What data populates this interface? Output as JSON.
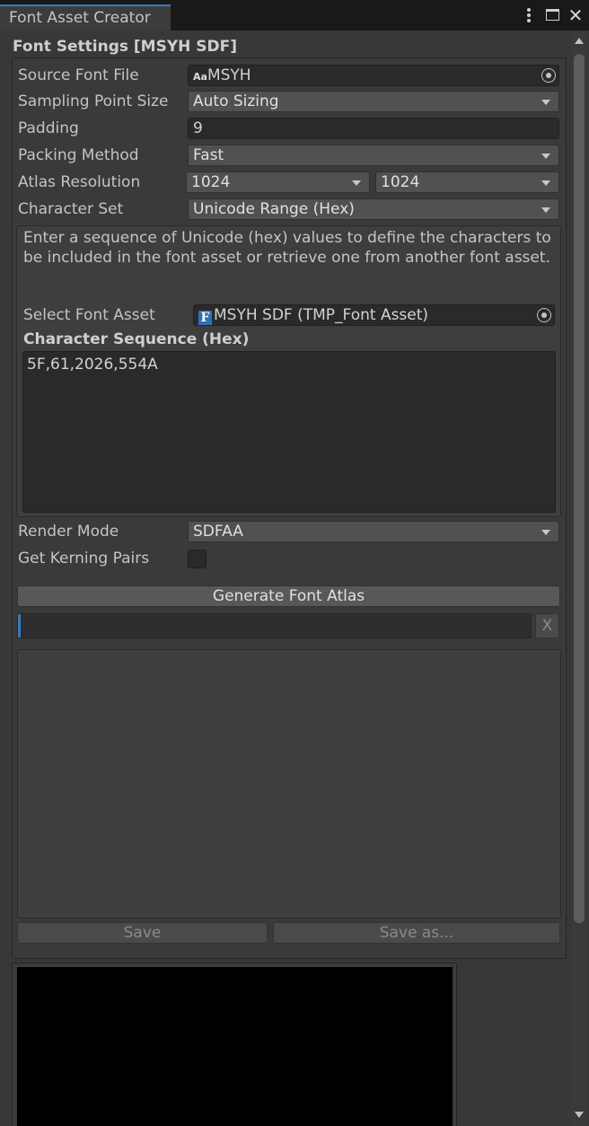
{
  "window": {
    "tab_title": "Font Asset Creator",
    "more_icon": "vertical-ellipsis-icon",
    "maximize_icon": "maximize-icon",
    "close_icon": "close-icon",
    "close_glyph": "✕"
  },
  "panel": {
    "header": "Font Settings [MSYH SDF]",
    "source_font_file": {
      "label": "Source Font File",
      "icon_text": "Aa",
      "value": "MSYH"
    },
    "sampling_point_size": {
      "label": "Sampling Point Size",
      "value": "Auto Sizing"
    },
    "padding": {
      "label": "Padding",
      "value": "9"
    },
    "packing_method": {
      "label": "Packing Method",
      "value": "Fast"
    },
    "atlas_resolution": {
      "label": "Atlas Resolution",
      "width": "1024",
      "height": "1024"
    },
    "character_set": {
      "label": "Character Set",
      "value": "Unicode Range (Hex)"
    },
    "help_text": "Enter a sequence of Unicode (hex) values to define the characters to be included in the font asset or retrieve one from another font asset.",
    "select_font_asset": {
      "label": "Select Font Asset",
      "icon_text": "F",
      "value": "MSYH SDF (TMP_Font Asset)"
    },
    "character_sequence": {
      "label": "Character Sequence (Hex)",
      "value": "5F,61,2026,554A"
    },
    "render_mode": {
      "label": "Render Mode",
      "value": "SDFAA"
    },
    "get_kerning_pairs": {
      "label": "Get Kerning Pairs",
      "checked": false
    },
    "generate_button": "Generate Font Atlas",
    "progress": {
      "value": 0,
      "clear_label": "X"
    },
    "output_text": "",
    "save_button": "Save",
    "save_as_button": "Save as..."
  },
  "colors": {
    "background": "#383838",
    "field": "#2a2a2a",
    "dropdown": "#515151",
    "accent": "#3a79bb",
    "preview": "#000000"
  }
}
